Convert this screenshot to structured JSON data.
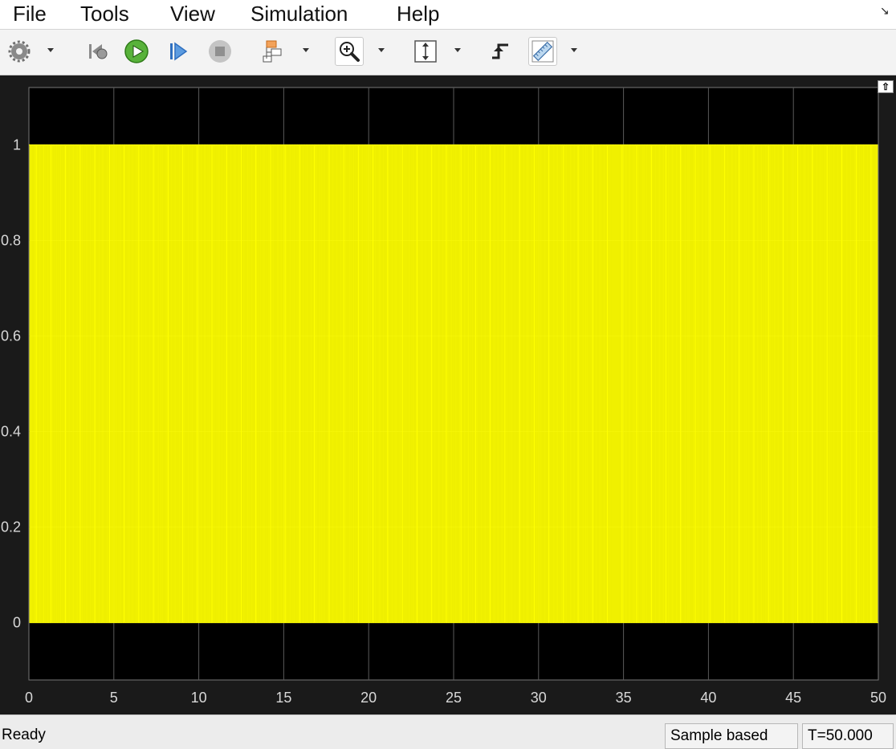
{
  "menu": {
    "items": [
      "File",
      "Tools",
      "View",
      "Simulation",
      "Help"
    ]
  },
  "toolbar": {
    "buttons": [
      {
        "name": "settings-icon"
      },
      {
        "name": "step-back-icon"
      },
      {
        "name": "run-icon"
      },
      {
        "name": "step-forward-icon"
      },
      {
        "name": "stop-icon"
      },
      {
        "name": "highlight-block-icon"
      },
      {
        "name": "zoom-in-icon"
      },
      {
        "name": "scale-axes-icon"
      },
      {
        "name": "triggers-icon"
      },
      {
        "name": "measurements-icon"
      }
    ]
  },
  "colors": {
    "plot_background": "#000000",
    "figure_background": "#1a1a1a",
    "signal": "#ffff00",
    "grid": "#5a5a5a",
    "tick_text": "#d8d8d8"
  },
  "chart_data": {
    "type": "line",
    "title": "",
    "xlabel": "",
    "ylabel": "",
    "xlim": [
      0,
      50
    ],
    "ylim": [
      -0.12,
      1.12
    ],
    "x_ticks": [
      "0",
      "5",
      "10",
      "15",
      "20",
      "25",
      "30",
      "35",
      "40",
      "45",
      "50"
    ],
    "y_ticks": [
      "0",
      "0.2",
      "0.4",
      "0.6",
      "0.8",
      "1"
    ],
    "grid": true,
    "series": [
      {
        "style": "square-wave",
        "low": 0,
        "high": 1,
        "period": 0.1,
        "duty_cycle": 0.5,
        "x_start": 0,
        "x_end": 50
      }
    ]
  },
  "status": {
    "ready": "Ready",
    "mode": "Sample based",
    "time": "T=50.000"
  }
}
